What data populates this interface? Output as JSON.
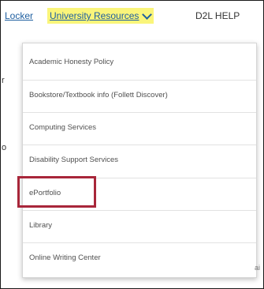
{
  "nav": {
    "locker": "Locker",
    "resources": "University Resources",
    "help": "D2L HELP"
  },
  "background": {
    "left_char_1": "r",
    "left_char_2": "o",
    "right_partial": "ai"
  },
  "dropdown": {
    "items": [
      {
        "label": "Academic Honesty Policy"
      },
      {
        "label": "Bookstore/Textbook info (Follett Discover)"
      },
      {
        "label": "Computing Services"
      },
      {
        "label": "Disability Support Services"
      },
      {
        "label": "ePortfolio"
      },
      {
        "label": "Library"
      },
      {
        "label": "Online Writing Center"
      }
    ],
    "highlighted_item": "ePortfolio"
  },
  "colors": {
    "link": "#1f5fa0",
    "highlight_bg": "#faf57a",
    "callout_border": "#a8263a"
  }
}
